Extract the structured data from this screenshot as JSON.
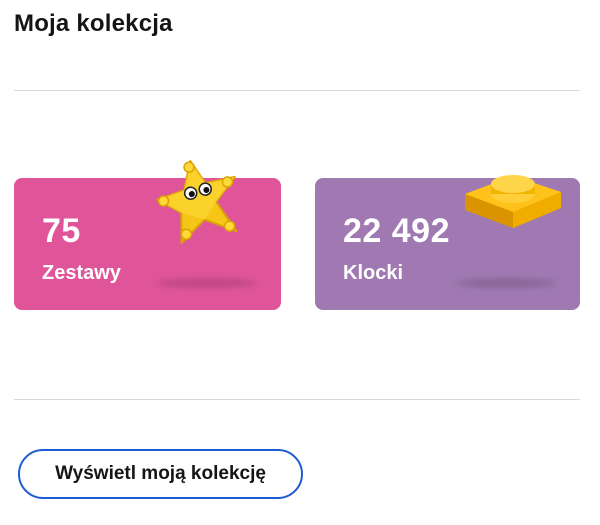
{
  "page": {
    "title": "Moja kolekcja"
  },
  "cards": [
    {
      "value": "75",
      "label": "Zestawy",
      "color": "#e0559a",
      "figure": "yellow-star-figure"
    },
    {
      "value": "22 492",
      "label": "Klocki",
      "color": "#a079b3",
      "figure": "yellow-plate-brick"
    }
  ],
  "cta": {
    "label": "Wyświetl moją kolekcję",
    "border_color": "#1f5bd1"
  }
}
